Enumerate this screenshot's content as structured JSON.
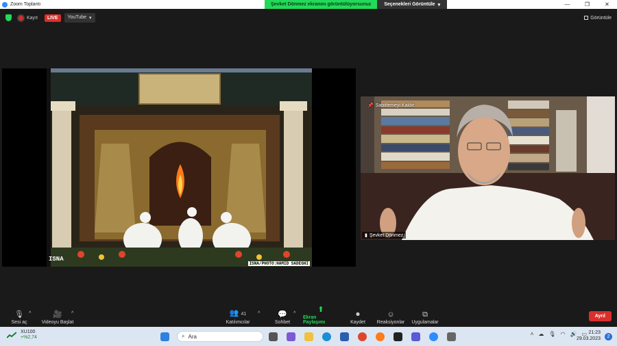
{
  "window": {
    "title": "Zoom Toplantı"
  },
  "share_banner": {
    "message": "Şevket Dönmez ekranını görüntülüyorsunuz",
    "options_label": "Seçenekleri Görüntüle"
  },
  "topbar": {
    "recording_label": "Kayıt",
    "live_badge": "LIVE",
    "stream_target": "YouTube",
    "view_label": "Görüntüle"
  },
  "shared_screen": {
    "watermark_left": "ISNA",
    "watermark_right": "ISNA/PHOTO:HAMID SADEGHI"
  },
  "speaker": {
    "name": "Şevket Dönmez",
    "unpin_label": "Sabitlemeyi Kaldır"
  },
  "toolbar": {
    "audio_label": "Sesi aç",
    "video_label": "Videoyu Başlat",
    "participants_label": "Katılımcılar",
    "participants_count": "41",
    "chat_label": "Sohbet",
    "share_label": "Ekran Paylaşımı",
    "record_label": "Kaydet",
    "reactions_label": "Reaksiyonlar",
    "apps_label": "Uygulamalar",
    "leave_label": "Ayrıl"
  },
  "taskbar": {
    "stock_name": "XU100",
    "stock_change": "+%2,74",
    "search_placeholder": "Ara",
    "time": "21:23",
    "date": "29.03.2023",
    "notification_count": "2"
  },
  "colors": {
    "zoom_green": "#23d959",
    "leave_red": "#d9302c",
    "zoom_blue": "#2d8cff"
  }
}
